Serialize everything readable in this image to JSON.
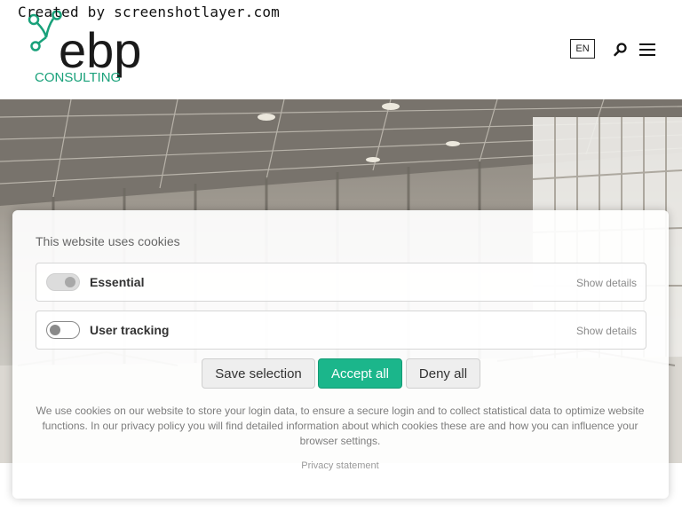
{
  "watermark": "Created by screenshotlayer.com",
  "header": {
    "logo_letters": "ebp",
    "logo_sub": "CONSULTING",
    "language": "EN",
    "icons": {
      "search": "search-icon",
      "menu": "hamburger-menu-icon"
    }
  },
  "colors": {
    "accent": "#1bb68b",
    "logo_green": "#19a17a",
    "text": "#333333"
  },
  "cookie_banner": {
    "title": "This website uses cookies",
    "options": [
      {
        "label": "Essential",
        "details": "Show details",
        "enabled": true,
        "locked": true
      },
      {
        "label": "User tracking",
        "details": "Show details",
        "enabled": false,
        "locked": false
      }
    ],
    "buttons": {
      "save": "Save selection",
      "accept": "Accept all",
      "deny": "Deny all"
    },
    "description": "We use cookies on our website to store your login data, to ensure a secure login and to collect statistical data to optimize website functions. In our privacy policy you will find detailed information about which cookies these are and how you can influence your browser settings.",
    "privacy_link": "Privacy statement"
  }
}
